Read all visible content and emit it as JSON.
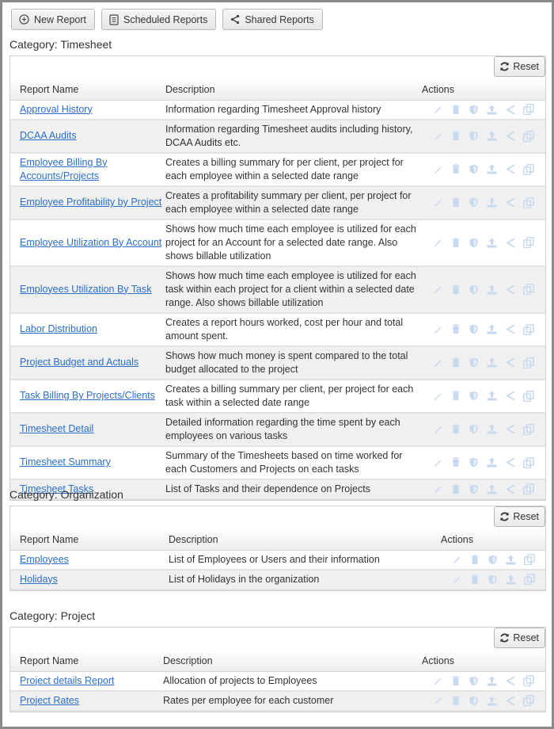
{
  "toolbar": {
    "new_report": "New Report",
    "scheduled_reports": "Scheduled Reports",
    "shared_reports": "Shared Reports"
  },
  "colors": {
    "link": "#2a6fc9",
    "action_icon": "#c7d9ee"
  },
  "reset_label": "Reset",
  "columns": {
    "name": "Report Name",
    "description": "Description",
    "actions": "Actions"
  },
  "categories": [
    {
      "title": "Category: Timesheet",
      "actions": [
        "edit-icon",
        "delete-icon",
        "security-icon",
        "export-icon",
        "share-icon",
        "copy-icon"
      ],
      "rows": [
        {
          "name": "Approval History",
          "description": "Information regarding Timesheet Approval history"
        },
        {
          "name": "DCAA Audits",
          "description": "Information regarding Timesheet audits including history, DCAA Audits etc."
        },
        {
          "name": "Employee Billing By Accounts/Projects",
          "description": "Creates a billing summary for per client, per project for each employee within a selected date range"
        },
        {
          "name": "Employee Profitability by Project",
          "description": "Creates a profitability summary per client, per project for each employee within a selected date range"
        },
        {
          "name": "Employee Utilization By Account",
          "description": "Shows how much time each employee is utilized for each project for an Account for a selected date range. Also shows billable utilization"
        },
        {
          "name": "Employees Utilization By Task",
          "description": "Shows how much time each employee is utilized for each task within each project for a client within a selected date range. Also shows billable utilization"
        },
        {
          "name": "Labor Distribution",
          "description": "Creates a report hours worked, cost per hour and total amount spent."
        },
        {
          "name": "Project Budget and Actuals",
          "description": "Shows how much money is spent compared to the total budget allocated to the project"
        },
        {
          "name": "Task Billing By Projects/Clients",
          "description": "Creates a billing summary per client, per project for each task within a selected date range"
        },
        {
          "name": "Timesheet Detail",
          "description": "Detailed information regarding the time spent by each employees on various tasks"
        },
        {
          "name": "Timesheet Summary",
          "description": "Summary of the Timesheets based on time worked for each Customers and Projects on each tasks"
        },
        {
          "name": "Timesheet Tasks",
          "description": "List of Tasks and their dependence on Projects"
        }
      ]
    },
    {
      "title": "Category: Organization",
      "actions": [
        "edit-icon",
        "delete-icon",
        "security-icon",
        "export-icon",
        "copy-icon"
      ],
      "rows": [
        {
          "name": "Employees",
          "description": "List of Employees or Users and their information"
        },
        {
          "name": "Holidays",
          "description": "List of Holidays in the organization"
        }
      ]
    },
    {
      "title": "Category: Project",
      "actions": [
        "edit-icon",
        "delete-icon",
        "security-icon",
        "export-icon",
        "share-icon",
        "copy-icon"
      ],
      "rows": [
        {
          "name": "Project details Report",
          "description": "Allocation of projects to Employees"
        },
        {
          "name": "Project Rates",
          "description": "Rates per employee for each customer"
        }
      ]
    }
  ]
}
